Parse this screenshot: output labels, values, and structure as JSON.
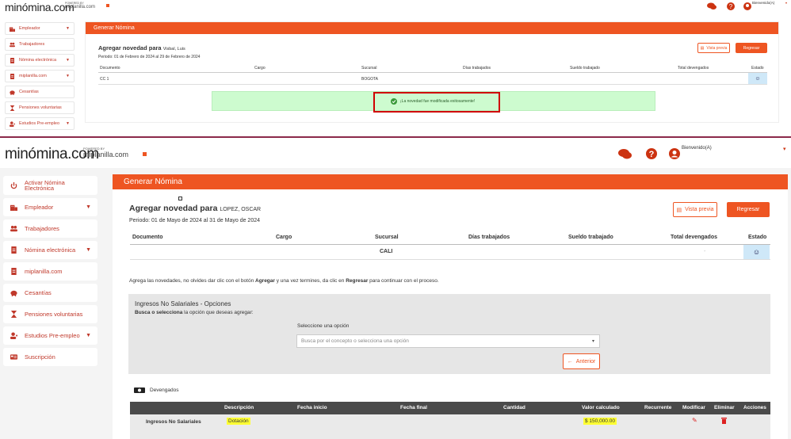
{
  "top": {
    "logo": {
      "main": "minómina.com",
      "powered": "POWERED BY",
      "sub": "miplanilla.com"
    },
    "user": {
      "label": "Bienvenido(A)"
    },
    "sidebar": [
      {
        "label": "Empleador",
        "icon": "building-icon",
        "chevron": true
      },
      {
        "label": "Trabajadores",
        "icon": "users-icon",
        "chevron": false
      },
      {
        "label": "Nómina electrónica",
        "icon": "document-icon",
        "chevron": true
      },
      {
        "label": "miplanilla.com",
        "icon": "document-icon",
        "chevron": true
      },
      {
        "label": "Cesantías",
        "icon": "piggy-bank-icon",
        "chevron": false
      },
      {
        "label": "Pensiones voluntarias",
        "icon": "hourglass-icon",
        "chevron": false
      },
      {
        "label": "Estudios Pre-empleo",
        "icon": "user-check-icon",
        "chevron": true
      }
    ],
    "bar_title": "Generar Nómina",
    "heading": "Agregar novedad para",
    "employee": "Visbal, Luis",
    "period": "Periodo: 01 de Febrero de 2024 al 29 de Febrero de 2024",
    "preview_label": "Vista previa",
    "back_label": "Regresar",
    "columns": [
      "Documento",
      "Cargo",
      "Sucursal",
      "Días trabajados",
      "Sueldo trabajado",
      "Total devengados",
      "Estado"
    ],
    "row": {
      "documento": "CC 1",
      "sucursal": "BOGOTA"
    },
    "success_message": "¡La novedad fue modificada exitosamente!"
  },
  "bottom": {
    "logo": {
      "main": "minómina.com",
      "powered": "POWERED BY",
      "sub": "miplanilla.com"
    },
    "user": {
      "label": "Bienvenido(A)"
    },
    "sidebar": [
      {
        "label": "Activar Nómina Electrónica",
        "icon": "power-icon",
        "chevron": false
      },
      {
        "label": "Empleador",
        "icon": "building-icon",
        "chevron": true
      },
      {
        "label": "Trabajadores",
        "icon": "users-icon",
        "chevron": false
      },
      {
        "label": "Nómina electrónica",
        "icon": "document-icon",
        "chevron": true
      },
      {
        "label": "miplanilla.com",
        "icon": "document-icon",
        "chevron": false
      },
      {
        "label": "Cesantías",
        "icon": "piggy-bank-icon",
        "chevron": false
      },
      {
        "label": "Pensiones voluntarias",
        "icon": "hourglass-icon",
        "chevron": false
      },
      {
        "label": "Estudios Pre-empleo",
        "icon": "user-check-icon",
        "chevron": true
      },
      {
        "label": "Suscripción",
        "icon": "card-icon",
        "chevron": false
      }
    ],
    "bar_title": "Generar Nómina",
    "heading": "Agregar novedad para",
    "employee": "LOPEZ, OSCAR",
    "period": "Periodo: 01 de Mayo de 2024 al 31 de Mayo de 2024",
    "preview_label": "Vista previa",
    "back_label": "Regresar",
    "columns": [
      "Documento",
      "Cargo",
      "Sucursal",
      "Días trabajados",
      "Sueldo trabajado",
      "Total devengados",
      "Estado"
    ],
    "row": {
      "sucursal": "CALI",
      "total": "-"
    },
    "instructions": {
      "p1": "Agrega las novedades, no olvides dar clic con el botón ",
      "b1": "Agregar",
      "p2": " y una vez termines, da clic en ",
      "b2": "Regresar",
      "p3": " para continuar con el proceso."
    },
    "panel": {
      "title": "Ingresos No Salariales - Opciones",
      "subtitle_bold": "Busca o selecciona",
      "subtitle_rest": " la opción que deseas agregar:",
      "select_label": "Seleccione una opción",
      "select_placeholder": "Busca por el concepto o selecciona una opción",
      "anterior_label": "Anterior"
    },
    "devengados_label": "Devengados",
    "table": {
      "columns": [
        "Descripción",
        "Fecha inicio",
        "Fecha final",
        "Cantidad",
        "Valor calculado",
        "Recurrente",
        "Modificar",
        "Eliminar",
        "Acciones"
      ],
      "row": {
        "group": "Ingresos No Salariales",
        "descripcion": "Dotación",
        "valor": "$ 150,000.00"
      }
    }
  },
  "colors": {
    "accent": "#ee5522",
    "success_bg": "#cdfbcf",
    "highlight": "#ffff33",
    "estado_bg": "#cfe8f8"
  }
}
